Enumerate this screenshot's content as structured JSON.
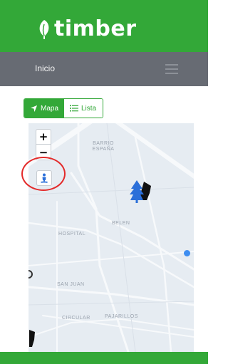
{
  "app": {
    "logo_text": "timber"
  },
  "nav": {
    "title": "Inicio"
  },
  "view_toggle": {
    "map_label": "Mapa",
    "list_label": "Lista",
    "selected": "Mapa"
  },
  "map": {
    "zoom_in_label": "+",
    "zoom_out_label": "−",
    "labels": {
      "barrio_1": "BARRIO",
      "barrio_2": "ESPAÑA",
      "belen": "BELEN",
      "hospital": "HOSPITAL",
      "san_juan": "SAN JUAN",
      "circular": "CIRCULAR",
      "pajarillos": "PAJARILLOS"
    }
  },
  "colors": {
    "brand": "#33a838",
    "navbar": "#676b73",
    "highlight": "#e32a2a",
    "location_dot": "#3d8df0",
    "tree_primary": "#2b6fd9"
  }
}
